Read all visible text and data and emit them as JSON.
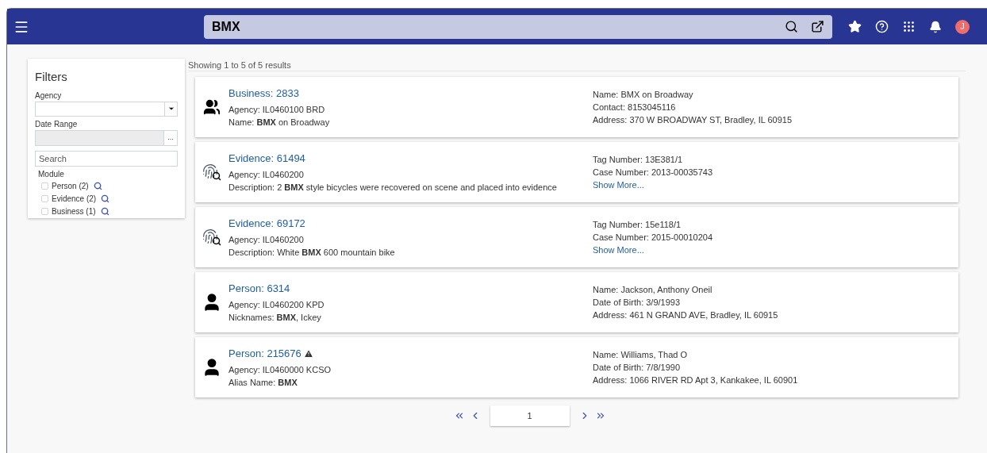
{
  "top_bar": {
    "search_value": "BMX",
    "avatar_letter": "J"
  },
  "filters": {
    "title": "Filters",
    "agency_label": "Agency",
    "date_range_label": "Date Range",
    "date_button": "...",
    "search_placeholder": "Search",
    "module_label": "Module",
    "modules": [
      {
        "label": "Person (2)",
        "checked": false
      },
      {
        "label": "Evidence (2)",
        "checked": false
      },
      {
        "label": "Business (1)",
        "checked": false
      }
    ]
  },
  "summary": "Showing 1 to 5 of 5 results",
  "results": [
    {
      "kind": "business",
      "title": "Business: 2833",
      "warning": false,
      "left": [
        "Agency: IL0460100 BRD",
        "Name: **BMX** on Broadway"
      ],
      "right": [
        "Name: BMX on Broadway",
        "Contact: 8153045116",
        "Address: 370 W BROADWAY ST, Bradley, IL 60915"
      ]
    },
    {
      "kind": "evidence",
      "title": "Evidence: 61494",
      "warning": false,
      "left": [
        "Agency: IL0460200",
        "Description: 2 **BMX** style bicycles were recovered on scene and placed into evidence"
      ],
      "right": [
        "Tag Number: 13E381/1",
        "Case Number: 2013-00035743"
      ],
      "more": "Show More..."
    },
    {
      "kind": "evidence",
      "title": "Evidence: 69172",
      "warning": false,
      "left": [
        "Agency: IL0460200",
        "Description: White **BMX** 600 mountain bike"
      ],
      "right": [
        "Tag Number: 15e118/1",
        "Case Number: 2015-00010204"
      ],
      "more": "Show More..."
    },
    {
      "kind": "person",
      "title": "Person: 6314",
      "warning": false,
      "left": [
        "Agency: IL0460200 KPD",
        "Nicknames: **BMX**, Ickey"
      ],
      "right": [
        "Name: Jackson, Anthony Oneil",
        "Date of Birth: 3/9/1993",
        "Address: 461 N GRAND AVE, Bradley, IL 60915"
      ]
    },
    {
      "kind": "person",
      "title": "Person: 215676",
      "warning": true,
      "left": [
        "Agency: IL0460000 KCSO",
        "Alias Name: **BMX**"
      ],
      "right": [
        "Name: Williams, Thad O",
        "Date of Birth: 7/8/1990",
        "Address: 1066 RIVER RD Apt 3, Kankakee, IL 60901"
      ]
    }
  ],
  "pagination": {
    "page": "1"
  }
}
